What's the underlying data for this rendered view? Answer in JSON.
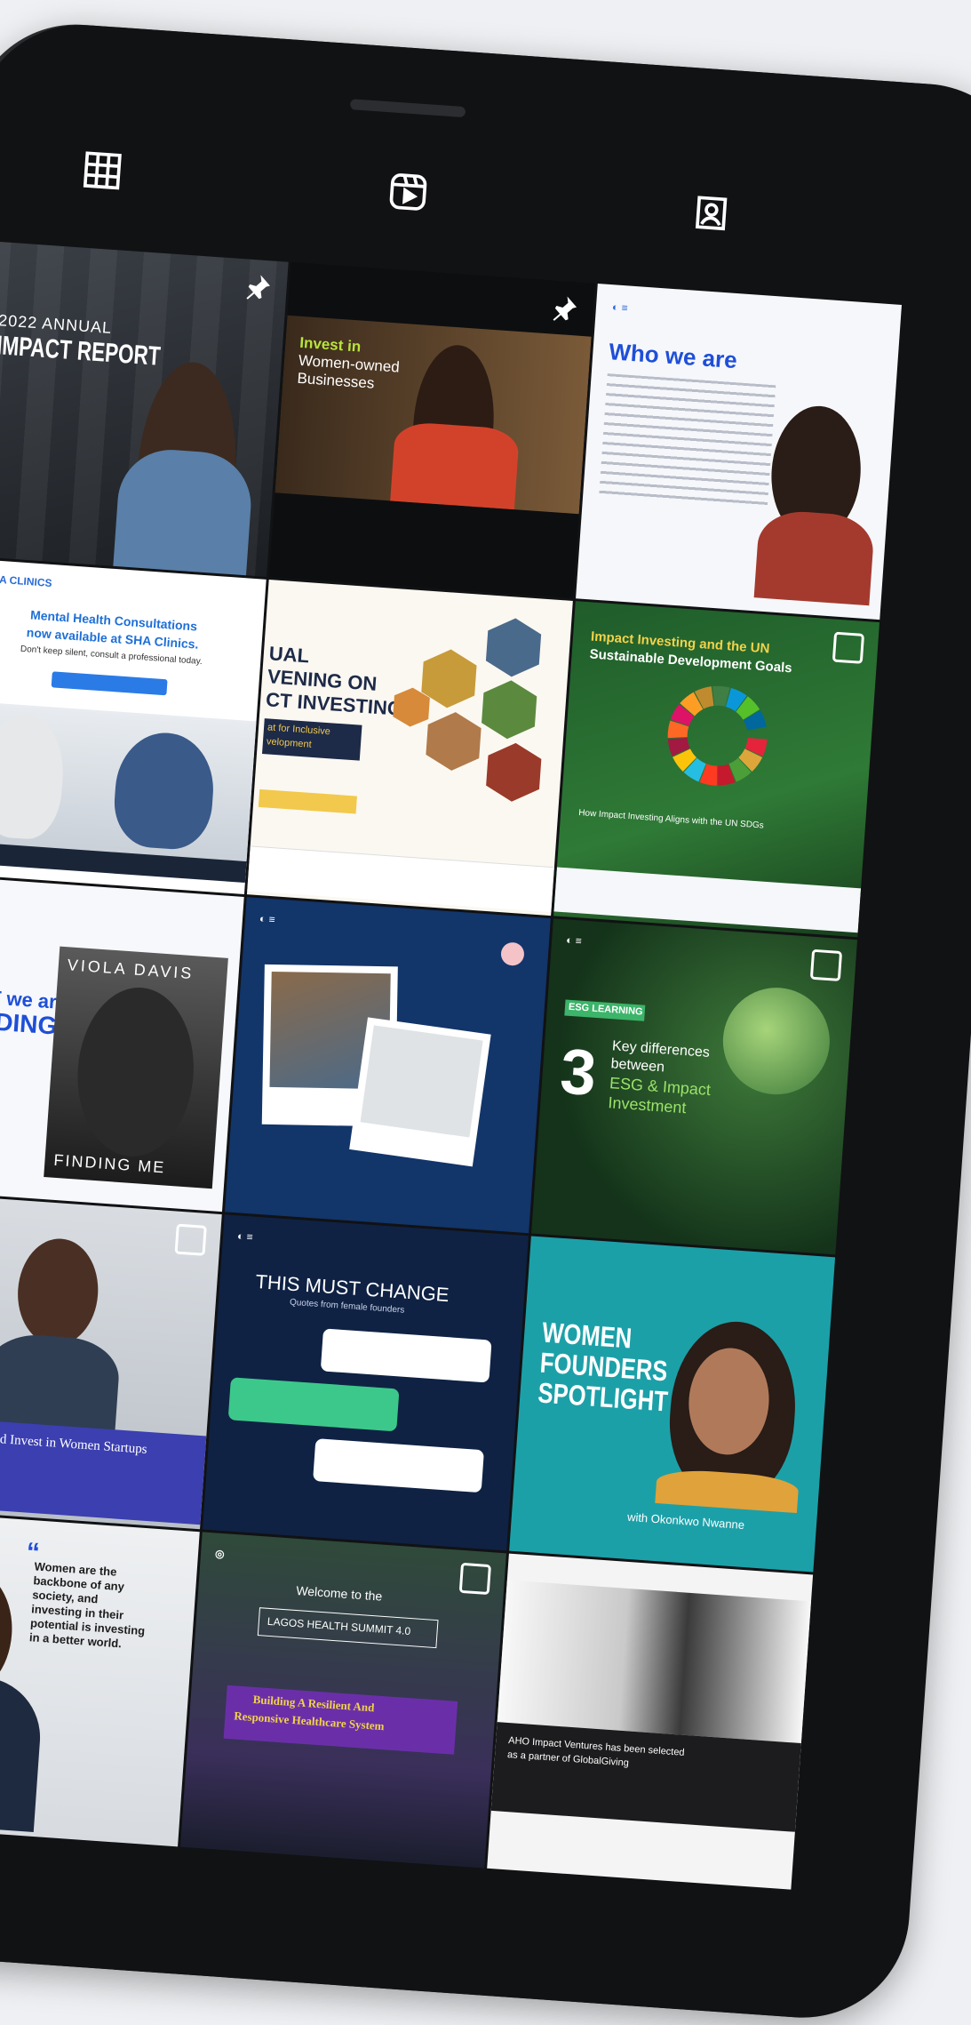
{
  "profile_tabs": [
    {
      "name": "grid",
      "icon": "grid-icon"
    },
    {
      "name": "reels",
      "icon": "reels-icon"
    },
    {
      "name": "tagged",
      "icon": "tagged-icon"
    }
  ],
  "posts": [
    {
      "id": "impact-report",
      "lines": [
        "2022 ANNUAL",
        "IMPACT REPORT"
      ],
      "pinned": true
    },
    {
      "id": "invest-women",
      "lines": [
        "Invest in",
        "Women-owned",
        "Businesses"
      ],
      "pinned": true
    },
    {
      "id": "who-we-are",
      "lines": [
        "Who we are"
      ]
    },
    {
      "id": "mental-health",
      "lines": [
        "Mental Health Consultations",
        "now available at SHA Clinics.",
        "Don't keep silent, consult a professional today."
      ]
    },
    {
      "id": "evening",
      "lines": [
        "UAL",
        "VENING ON",
        "CT INVESTING",
        "at for Inclusive",
        "velopment"
      ]
    },
    {
      "id": "sdgs",
      "lines": [
        "Impact Investing and the UN",
        "Sustainable Development Goals",
        "How Impact Investing Aligns with the UN SDGs"
      ]
    },
    {
      "id": "reading",
      "lines": [
        "WHAT we are",
        "READING",
        "VIOLA DAVIS",
        "FINDING ME"
      ]
    },
    {
      "id": "lab",
      "lines": []
    },
    {
      "id": "esg",
      "lines": [
        "ESG LEARNING",
        "3",
        "Key differences",
        "between",
        "ESG & Impact",
        "Investment"
      ]
    },
    {
      "id": "women-startups",
      "lines": [
        "Why You Should Invest in Women Startups"
      ]
    },
    {
      "id": "must-change",
      "lines": [
        "THIS MUST CHANGE",
        "Quotes from female founders"
      ]
    },
    {
      "id": "founders-spotlight",
      "lines": [
        "WOMEN",
        "FOUNDERS",
        "SPOTLIGHT",
        "with Okonkwo Nwanne"
      ]
    },
    {
      "id": "women-quote",
      "lines": [
        "Women are the",
        "backbone of any",
        "society, and",
        "investing in their",
        "potential is investing",
        "in a better world."
      ]
    },
    {
      "id": "health-summit",
      "lines": [
        "Welcome to the",
        "LAGOS HEALTH SUMMIT 4.0",
        "Building A Resilient And",
        "Responsive Healthcare System"
      ]
    },
    {
      "id": "handshake",
      "lines": [
        "AHO Impact Ventures has been selected",
        "as a partner of GlobalGiving"
      ]
    }
  ],
  "colors": {
    "accent_blue": "#1e4fd8",
    "navy": "#0f2244",
    "teal": "#1ca0a8",
    "green": "#1e5a2a"
  }
}
